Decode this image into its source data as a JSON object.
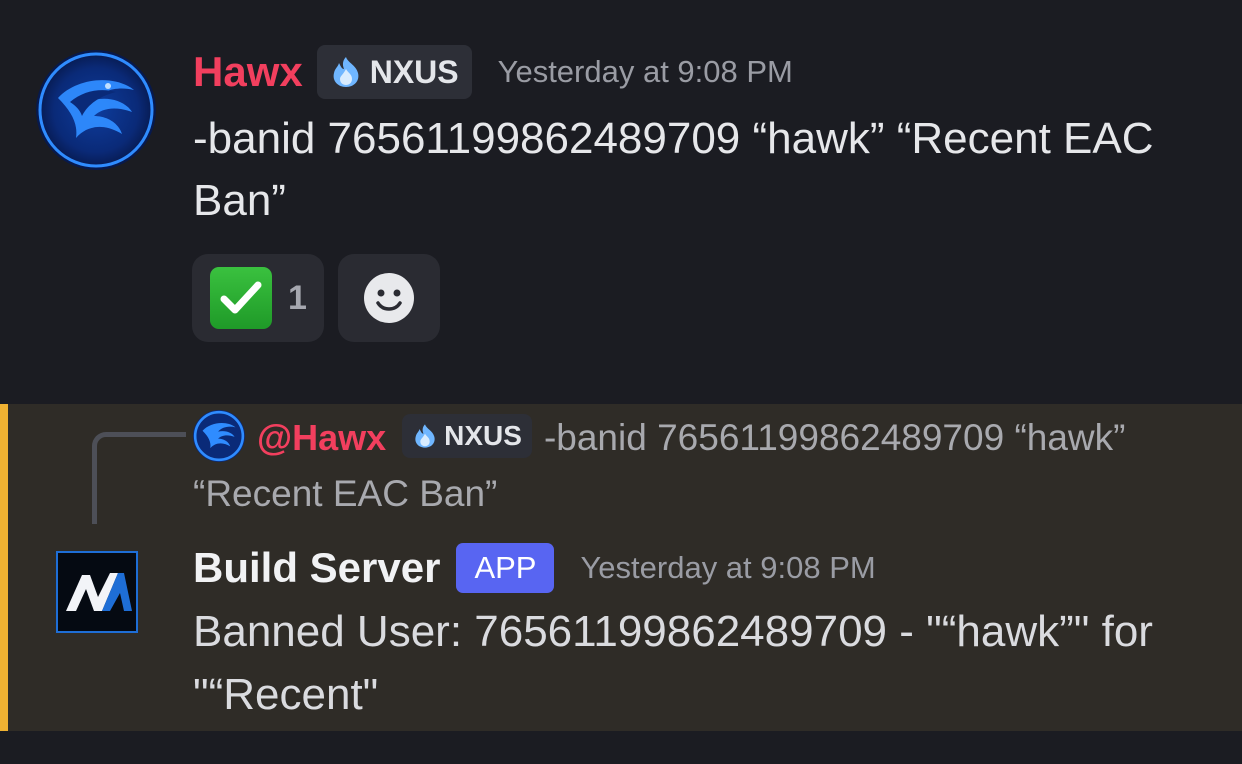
{
  "message1": {
    "author": "Hawx",
    "tag": "NXUS",
    "timestamp": "Yesterday at 9:08 PM",
    "content": "-banid 76561199862489709 “hawk” “Recent EAC Ban”",
    "reactions": [
      {
        "emoji": "white-check-mark",
        "count": "1"
      }
    ],
    "add_reaction_icon": "smiley-icon"
  },
  "message2": {
    "reply": {
      "author": "@Hawx",
      "tag": "NXUS",
      "content": "-banid 76561199862489709 “hawk” “Recent EAC Ban”"
    },
    "author": "Build Server",
    "badge": "APP",
    "timestamp": "Yesterday at 9:08 PM",
    "content": "Banned User: 76561199862489709 - \"“hawk”\" for \"“Recent\""
  },
  "colors": {
    "background": "#1b1c22",
    "username_red": "#f23f5e",
    "highlight_bg": "#2f2c27",
    "highlight_bar": "#f0b232",
    "app_badge": "#5865f2"
  }
}
